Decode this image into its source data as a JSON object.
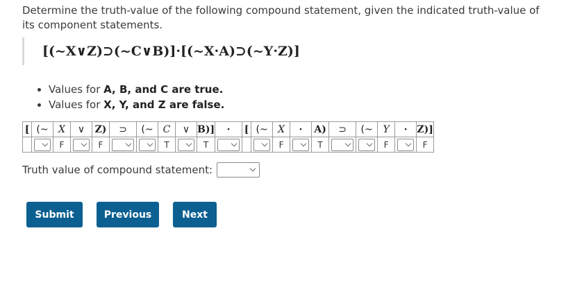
{
  "prompt": "Determine the truth-value of the following compound statement, given the indicated truth-value of its component statements.",
  "formula": "[(~X∨Z)⊃(~C∨B)]·[(~X·A)⊃(~Y·Z)]",
  "conditions": [
    {
      "prefix": "Values for ",
      "bold": "A, B, and C are true."
    },
    {
      "prefix": "Values for ",
      "bold": "X, Y, and Z are false."
    }
  ],
  "table": {
    "header": [
      "[",
      "(~",
      "X",
      "∨",
      "Z)",
      "⊃",
      "(~",
      "C",
      "∨",
      "B)]",
      "·",
      "[",
      "(~",
      "X",
      "·",
      "A)",
      "⊃",
      "(~",
      "Y",
      "·",
      "Z)]"
    ],
    "values": {
      "x1": "F",
      "z1": "F",
      "c1": "T",
      "b1": "T",
      "x2": "F",
      "a2": "T",
      "y2": "F",
      "z2": "F"
    }
  },
  "truth_label": "Truth value of compound statement:",
  "buttons": {
    "submit": "Submit",
    "previous": "Previous",
    "next": "Next"
  }
}
